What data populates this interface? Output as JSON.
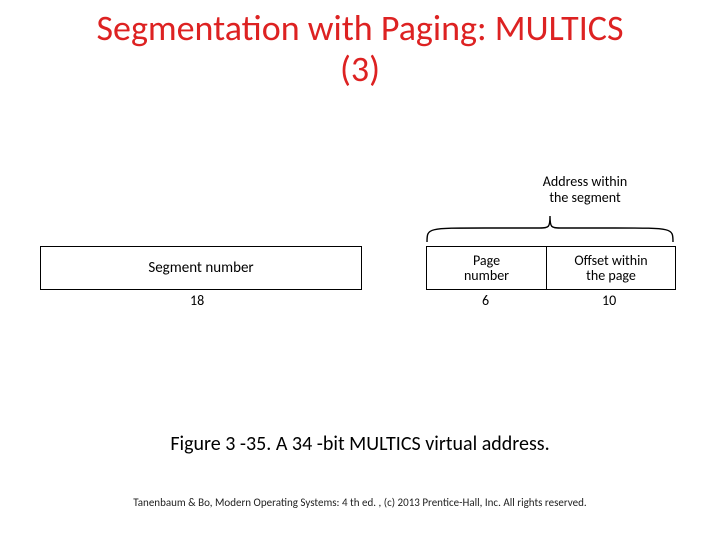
{
  "title_line1": "Segmentation with Paging: MULTICS",
  "title_line2": "(3)",
  "address_within_label": "Address within\nthe segment",
  "fields": {
    "segment": {
      "label": "Segment number",
      "bits": "18"
    },
    "page": {
      "label": "Page\nnumber",
      "bits": "6"
    },
    "offset": {
      "label": "Offset within\nthe page",
      "bits": "10"
    }
  },
  "caption": "Figure 3 -35. A 34 -bit MULTICS virtual address.",
  "footer": "Tanenbaum & Bo, Modern Operating Systems: 4 th ed. , (c) 2013 Prentice-Hall, Inc. All rights reserved."
}
